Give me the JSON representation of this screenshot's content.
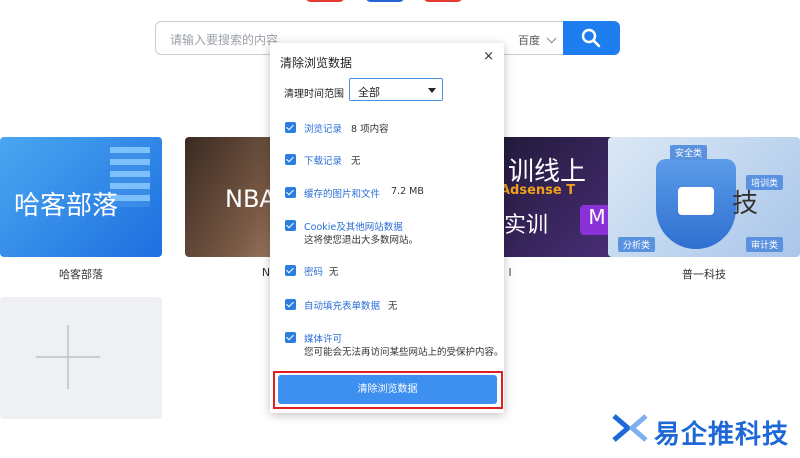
{
  "search": {
    "placeholder": "请输入要搜索的内容",
    "engine": "百度"
  },
  "tiles": [
    {
      "title": "哈客部落",
      "label": "哈客部落"
    },
    {
      "title": "NBA",
      "label": "N"
    },
    {
      "title_top": "训线上",
      "banner": "Adsense T",
      "title_bottom": "实训",
      "badge": "M",
      "label": "l"
    },
    {
      "title": "技",
      "label": "普一科技",
      "tags": [
        "安全类",
        "培训类",
        "分析类",
        "审计类"
      ]
    }
  ],
  "dialog": {
    "title": "清除浏览数据",
    "close": "×",
    "range_label": "清理时间范围",
    "range_value": "全部",
    "options": [
      {
        "label": "浏览记录",
        "value": "8 项内容",
        "desc": "",
        "checked": true
      },
      {
        "label": "下载记录",
        "value": "无",
        "desc": "",
        "checked": true
      },
      {
        "label": "缓存的图片和文件",
        "value": "7.2 MB",
        "desc": "",
        "checked": true
      },
      {
        "label": "Cookie及其他网站数据",
        "value": "",
        "desc": "这将使您退出大多数网站。",
        "checked": true
      },
      {
        "label": "密码",
        "value": "无",
        "desc": "",
        "checked": true
      },
      {
        "label": "自动填充表单数据",
        "value": "无",
        "desc": "",
        "checked": true
      },
      {
        "label": "媒体许可",
        "value": "",
        "desc": "您可能会无法再访问某些网站上的受保护内容。",
        "checked": true
      }
    ],
    "button": "清除浏览数据"
  },
  "watermark": {
    "text": "易企推科技"
  },
  "colors": {
    "accent": "#1e7ef0",
    "highlight": "#e02020",
    "watermark": "#1e68d8"
  }
}
